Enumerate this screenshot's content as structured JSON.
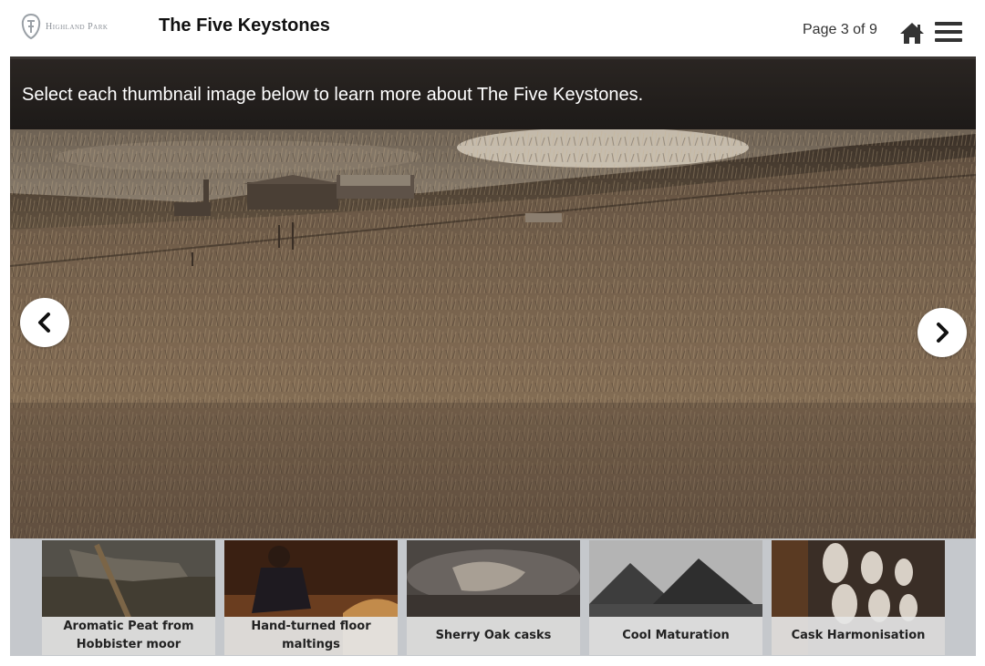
{
  "header": {
    "logo_text": "Highland Park",
    "course_title": "The Five Keystones",
    "page_indicator": "Page 3 of 9",
    "home_icon": "home-icon",
    "menu_icon": "hamburger-menu-icon"
  },
  "stage": {
    "instruction": "Select each thumbnail image below to learn more about The Five Keystones.",
    "photo_description_icon": "moorland-photo",
    "prev_icon": "chevron-left-icon",
    "next_icon": "chevron-right-icon"
  },
  "thumbnails": [
    {
      "label": "Aromatic Peat from Hobbister moor"
    },
    {
      "label": "Hand-turned floor maltings"
    },
    {
      "label": "Sherry Oak casks"
    },
    {
      "label": "Cool Maturation"
    },
    {
      "label": "Cask Harmonisation"
    }
  ],
  "colors": {
    "instruction_bar": "#221e1c",
    "thumb_strip": "#c5c8cc",
    "caption_bg": "#e6e6e6"
  }
}
